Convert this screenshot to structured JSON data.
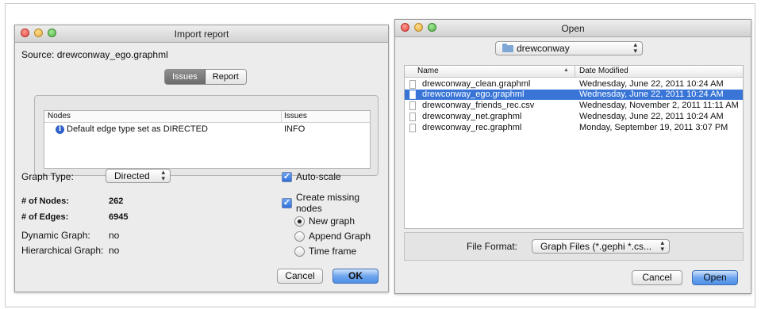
{
  "import_report": {
    "title": "Import report",
    "source": "Source: drewconway_ego.graphml",
    "tabs": [
      {
        "label": "Issues",
        "active": true
      },
      {
        "label": "Report",
        "active": false
      }
    ],
    "table": {
      "headers": [
        "Nodes",
        "Issues"
      ],
      "rows": [
        {
          "icon": "info-icon",
          "message": "Default edge type set as DIRECTED",
          "level": "INFO"
        }
      ]
    },
    "graph_type_label": "Graph Type:",
    "graph_type_value": "Directed",
    "stats": [
      {
        "label": "# of Nodes:",
        "value": "262"
      },
      {
        "label": "# of Edges:",
        "value": "6945"
      },
      {
        "label": "Dynamic Graph:",
        "value": "no"
      },
      {
        "label": "Hierarchical Graph:",
        "value": "no"
      }
    ],
    "checkboxes": [
      {
        "label": "Auto-scale",
        "checked": true
      },
      {
        "label": "Create missing nodes",
        "checked": true
      }
    ],
    "radios": [
      {
        "label": "New graph",
        "selected": true
      },
      {
        "label": "Append Graph",
        "selected": false
      },
      {
        "label": "Time frame",
        "selected": false
      }
    ],
    "cancel_label": "Cancel",
    "ok_label": "OK"
  },
  "open_dialog": {
    "title": "Open",
    "location": "drewconway",
    "columns": {
      "name": "Name",
      "date": "Date Modified"
    },
    "files": [
      {
        "name": "drewconway_clean.graphml",
        "date": "Wednesday, June 22, 2011 10:24 AM",
        "selected": false
      },
      {
        "name": "drewconway_ego.graphml",
        "date": "Wednesday, June 22, 2011 10:24 AM",
        "selected": true
      },
      {
        "name": "drewconway_friends_rec.csv",
        "date": "Wednesday, November 2, 2011 11:11 AM",
        "selected": false
      },
      {
        "name": "drewconway_net.graphml",
        "date": "Wednesday, June 22, 2011 10:24 AM",
        "selected": false
      },
      {
        "name": "drewconway_rec.graphml",
        "date": "Monday, September 19, 2011 3:07 PM",
        "selected": false
      }
    ],
    "file_format_label": "File Format:",
    "file_format_value": "Graph Files (*.gephi *.cs...",
    "cancel_label": "Cancel",
    "open_label": "Open"
  },
  "colors": {
    "selection": "#3875d7",
    "default_button": "#6fa6ee",
    "info_icon": "#2f62c8"
  }
}
